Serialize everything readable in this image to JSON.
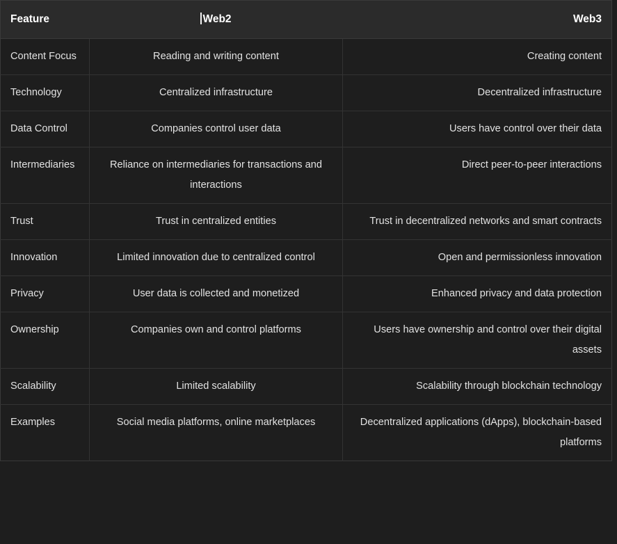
{
  "theme": {
    "page_background": "#1a1a1a",
    "table_background": "#1e1e1e",
    "header_background": "#2b2b2b",
    "border_color": "#333333",
    "header_text_color": "#ffffff",
    "body_text_color": "#e2e2e2",
    "caret_color": "#f2f2f2"
  },
  "table": {
    "name": "web2-vs-web3-comparison",
    "columns": [
      {
        "key": "feature",
        "label": "Feature",
        "align": "left"
      },
      {
        "key": "web2",
        "label": "Web2",
        "align": "center",
        "has_text_caret": true
      },
      {
        "key": "web3",
        "label": "Web3",
        "align": "right"
      }
    ],
    "rows": [
      {
        "feature": "Content Focus",
        "web2": "Reading and writing content",
        "web3": "Creating content"
      },
      {
        "feature": "Technology",
        "web2": "Centralized infrastructure",
        "web3": "Decentralized infrastructure"
      },
      {
        "feature": "Data Control",
        "web2": "Companies control user data",
        "web3": "Users have control over their data"
      },
      {
        "feature": "Intermediaries",
        "web2": "Reliance on intermediaries for transactions and interactions",
        "web3": "Direct peer-to-peer interactions"
      },
      {
        "feature": "Trust",
        "web2": "Trust in centralized entities",
        "web3": "Trust in decentralized networks and smart contracts"
      },
      {
        "feature": "Innovation",
        "web2": "Limited innovation due to centralized control",
        "web3": "Open and permissionless innovation"
      },
      {
        "feature": "Privacy",
        "web2": "User data is collected and monetized",
        "web3": "Enhanced privacy and data protection"
      },
      {
        "feature": "Ownership",
        "web2": "Companies own and control platforms",
        "web3": "Users have ownership and control over their digital assets"
      },
      {
        "feature": "Scalability",
        "web2": "Limited scalability",
        "web3": "Scalability through blockchain technology"
      },
      {
        "feature": "Examples",
        "web2": "Social media platforms, online marketplaces",
        "web3": "Decentralized applications (dApps), blockchain-based platforms"
      }
    ]
  }
}
